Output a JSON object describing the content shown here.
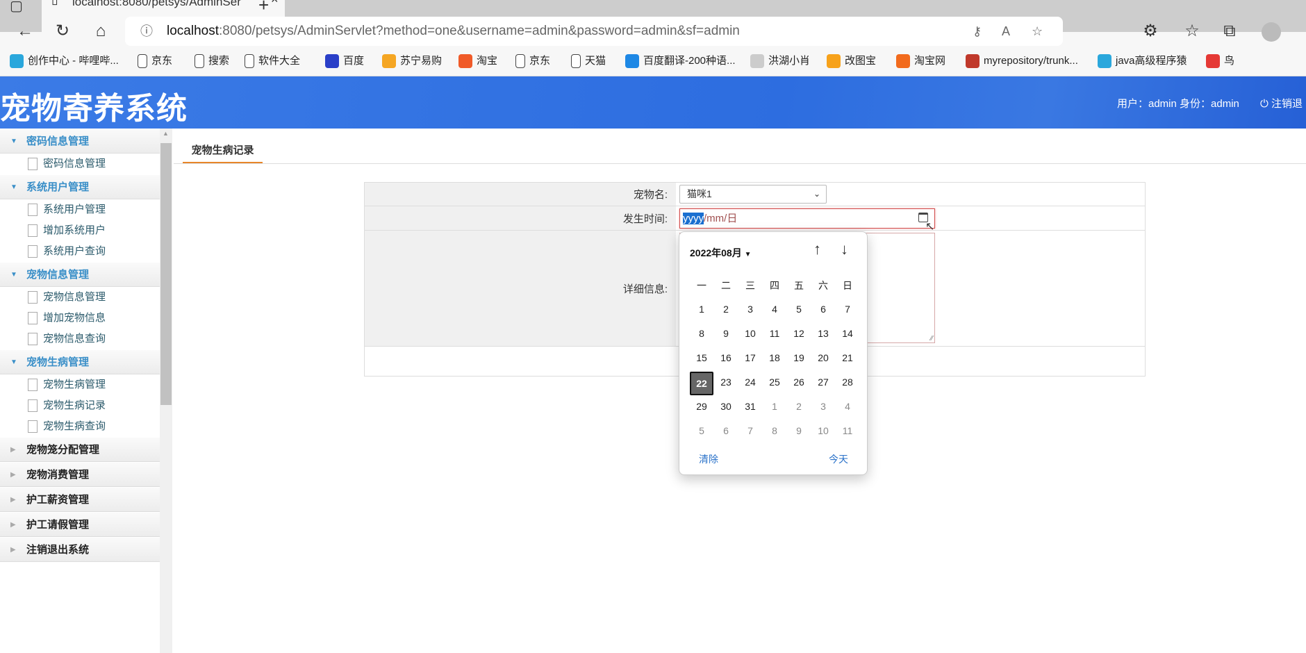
{
  "browser": {
    "tab_title": "localhost:8080/petsys/AdminSer",
    "url_host": "localhost",
    "url_rest": ":8080/petsys/AdminServlet?method=one&username=admin&password=admin&sf=admin",
    "bookmarks": [
      "创作中心 - 哔哩哔...",
      "京东",
      "搜索",
      "软件大全",
      "百度",
      "苏宁易购",
      "淘宝",
      "京东",
      "天猫",
      "百度翻译-200种语...",
      "洪湖小肖",
      "改图宝",
      "淘宝网",
      "myrepository/trunk...",
      "java高级程序猿",
      "鸟"
    ]
  },
  "header": {
    "title": "宠物寄养系统",
    "user_info": "用户：admin 身份：admin",
    "logout": "注销退"
  },
  "sidebar": {
    "groups": [
      {
        "label": "密码信息管理",
        "open": true,
        "items": [
          "密码信息管理"
        ]
      },
      {
        "label": "系统用户管理",
        "open": true,
        "items": [
          "系统用户管理",
          "增加系统用户",
          "系统用户查询"
        ]
      },
      {
        "label": "宠物信息管理",
        "open": true,
        "items": [
          "宠物信息管理",
          "增加宠物信息",
          "宠物信息查询"
        ]
      },
      {
        "label": "宠物生病管理",
        "open": true,
        "items": [
          "宠物生病管理",
          "宠物生病记录",
          "宠物生病查询"
        ]
      },
      {
        "label": "宠物笼分配管理",
        "open": false,
        "items": []
      },
      {
        "label": "宠物消费管理",
        "open": false,
        "items": []
      },
      {
        "label": "护工薪资管理",
        "open": false,
        "items": []
      },
      {
        "label": "护工请假管理",
        "open": false,
        "items": []
      },
      {
        "label": "注销退出系统",
        "open": false,
        "items": []
      }
    ]
  },
  "content": {
    "tab": "宠物生病记录",
    "form": {
      "pet_label": "宠物名:",
      "pet_value": "猫咪1",
      "time_label": "发生时间:",
      "time_placeholder_selected": "yyyy",
      "time_placeholder_rest": "/mm/日",
      "detail_label": "详细信息:"
    }
  },
  "calendar": {
    "month_label": "2022年08月",
    "weekdays": [
      "一",
      "二",
      "三",
      "四",
      "五",
      "六",
      "日"
    ],
    "weeks": [
      [
        "1",
        "2",
        "3",
        "4",
        "5",
        "6",
        "7"
      ],
      [
        "8",
        "9",
        "10",
        "11",
        "12",
        "13",
        "14"
      ],
      [
        "15",
        "16",
        "17",
        "18",
        "19",
        "20",
        "21"
      ],
      [
        "22",
        "23",
        "24",
        "25",
        "26",
        "27",
        "28"
      ],
      [
        "29",
        "30",
        "31",
        "1",
        "2",
        "3",
        "4"
      ],
      [
        "5",
        "6",
        "7",
        "8",
        "9",
        "10",
        "11"
      ]
    ],
    "today": "22",
    "clear": "清除",
    "today_button": "今天",
    "accent_color": "#2a72c9"
  }
}
